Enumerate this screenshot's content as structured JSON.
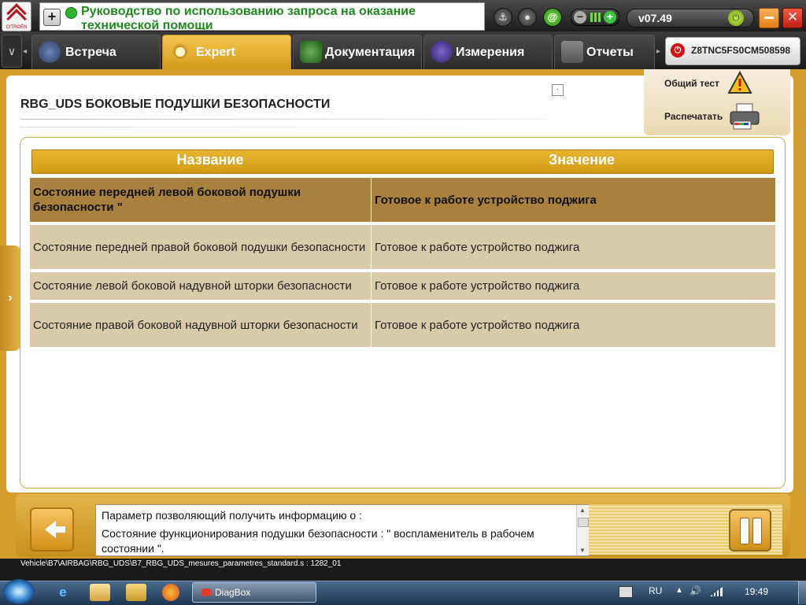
{
  "app": {
    "brand": "CITROËN",
    "message": "Руководство по использованию запроса на оказание технической помощи",
    "version": "v07.49"
  },
  "tabs": [
    {
      "label": "Встреча",
      "active": false
    },
    {
      "label": "Expert",
      "active": true
    },
    {
      "label": "Документация",
      "active": false
    },
    {
      "label": "Измерения",
      "active": false
    },
    {
      "label": "Отчеты",
      "active": false
    }
  ],
  "vin": "Z8TNC5FS0CM508598",
  "page": {
    "title": "RBG_UDS  БОКОВЫЕ ПОДУШКИ БЕЗОПАСНОСТИ",
    "small_button": "·"
  },
  "actions": {
    "test_label": "Общий тест",
    "print_label": "Распечатать"
  },
  "table": {
    "headers": [
      "Название",
      "Значение"
    ],
    "rows": [
      {
        "name": "Состояние передней левой боковой подушки безопасности \"",
        "value": "Готовое к работе устройство поджига",
        "selected": true
      },
      {
        "name": "Состояние передней правой боковой подушки безопасности",
        "value": "Готовое к работе устройство поджига",
        "selected": false
      },
      {
        "name": "Состояние левой боковой надувной шторки безопасности",
        "value": "Готовое к работе устройство поджига",
        "selected": false
      },
      {
        "name": "Состояние правой боковой надувной шторки безопасности",
        "value": "Готовое к работе устройство поджига",
        "selected": false
      }
    ]
  },
  "help": {
    "line1": "Параметр позволяющий получить информацию о :",
    "line2": "Состояние функционирования подушки безопасности : \" воспламенитель в рабочем состоянии \"."
  },
  "path": "Vehicle\\B7\\AIRBAG\\RBG_UDS\\B7_RBG_UDS_mesures_parametres_standard.s : 1282_01",
  "taskbar": {
    "diagbox_label": "DiagBox",
    "language": "RU",
    "clock": "19:49"
  },
  "colors": {
    "accent": "#d59d2b",
    "header": "#dba521",
    "selected_row": "#a8813e",
    "row": "#d9cba9",
    "message_green": "#1e8a1e"
  }
}
